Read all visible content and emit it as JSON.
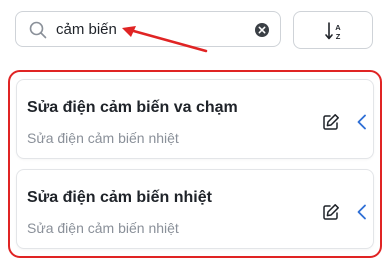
{
  "search": {
    "value": "cảm biến",
    "icon": "search-icon",
    "clear_icon": "clear-circle-icon"
  },
  "sort": {
    "icon": "sort-az-icon",
    "glyph_a": "A",
    "glyph_z": "Z"
  },
  "annotation": {
    "color": "#e02424"
  },
  "items": [
    {
      "title": "Sửa điện cảm biến va chạm",
      "subtitle": "Sửa điện cảm biến nhiệt"
    },
    {
      "title": "Sửa điện cảm biến nhiệt",
      "subtitle": "Sửa điện cảm biến nhiệt"
    }
  ],
  "colors": {
    "accent": "#2f6fd6",
    "highlight": "#e02424"
  }
}
